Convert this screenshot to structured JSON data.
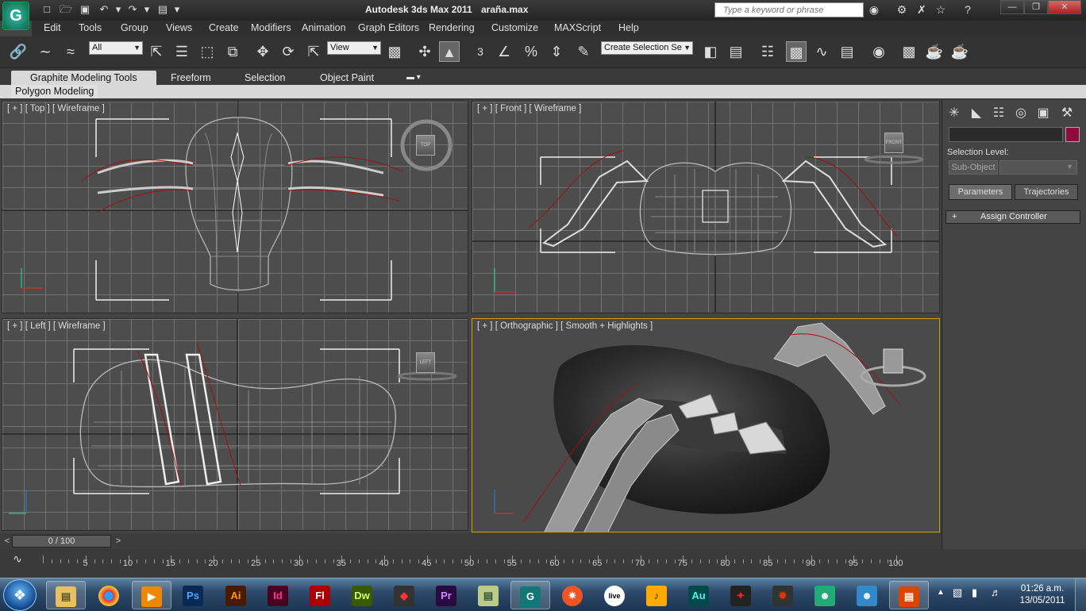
{
  "titlebar": {
    "app_title": "Autodesk 3ds Max  2011",
    "file_name": "araña.max",
    "search_placeholder": "Type a keyword or phrase",
    "logo_letter": "G"
  },
  "menu": [
    "Edit",
    "Tools",
    "Group",
    "Views",
    "Create",
    "Modifiers",
    "Animation",
    "Graph Editors",
    "Rendering",
    "Customize",
    "MAXScript",
    "Help"
  ],
  "toolbar": {
    "selection_filter": "All",
    "ref_coord": "View",
    "named_selection": "Create Selection Se",
    "snap_num": "3",
    "snap_angle": "%"
  },
  "ribbon": {
    "tabs": [
      "Graphite Modeling Tools",
      "Freeform",
      "Selection",
      "Object Paint"
    ],
    "panel": "Polygon Modeling"
  },
  "viewports": {
    "top": {
      "label": "[ + ] [ Top ] [ Wireframe ]",
      "cube": "TOP"
    },
    "front": {
      "label": "[ + ] [ Front ] [ Wireframe ]",
      "cube": "FRONT"
    },
    "left": {
      "label": "[ + ] [ Left ] [ Wireframe ]",
      "cube": "LEFT"
    },
    "persp": {
      "label": "[ + ] [ Orthographic ] [ Smooth + Highlights ]"
    }
  },
  "command_panel": {
    "selection_level": "Selection Level:",
    "sub_object": "Sub-Object",
    "parameters": "Parameters",
    "trajectories": "Trajectories",
    "rollout_sign": "+",
    "rollout": "Assign Controller"
  },
  "timeline": {
    "frame_display": "0 / 100",
    "prev": "<",
    "next": ">",
    "ticks": [
      "5",
      "10",
      "15",
      "20",
      "25",
      "30",
      "35",
      "40",
      "45",
      "50",
      "55",
      "60",
      "65",
      "70",
      "75",
      "80",
      "85",
      "90",
      "95",
      "100"
    ]
  },
  "taskbar": {
    "apps": [
      {
        "name": "explorer",
        "label": ""
      },
      {
        "name": "chrome",
        "label": ""
      },
      {
        "name": "media-player",
        "label": ""
      },
      {
        "name": "photoshop",
        "label": "Ps"
      },
      {
        "name": "illustrator",
        "label": "Ai"
      },
      {
        "name": "indesign",
        "label": "Id"
      },
      {
        "name": "flash",
        "label": "Fl"
      },
      {
        "name": "dreamweaver",
        "label": "Dw"
      },
      {
        "name": "app-1",
        "label": ""
      },
      {
        "name": "premiere",
        "label": "Pr"
      },
      {
        "name": "app-2",
        "label": ""
      },
      {
        "name": "3dsmax",
        "label": ""
      },
      {
        "name": "app-3",
        "label": ""
      },
      {
        "name": "ableton-live",
        "label": "live"
      },
      {
        "name": "fl-studio",
        "label": ""
      },
      {
        "name": "audition",
        "label": "Au"
      },
      {
        "name": "app-4",
        "label": ""
      },
      {
        "name": "app-5",
        "label": ""
      },
      {
        "name": "messenger-1",
        "label": ""
      },
      {
        "name": "messenger-2",
        "label": ""
      },
      {
        "name": "powerpoint",
        "label": ""
      }
    ],
    "time": "01:26 a.m.",
    "date": "13/05/2011"
  },
  "colors": {
    "selection_swatch": "#8a0d3c",
    "active_viewport_border": "#c8a400"
  }
}
